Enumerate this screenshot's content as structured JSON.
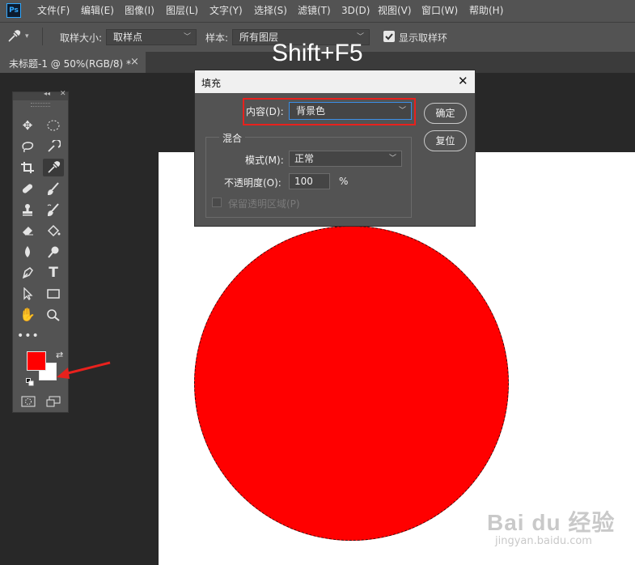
{
  "app": {
    "logo": "Ps"
  },
  "menu": [
    "文件(F)",
    "编辑(E)",
    "图像(I)",
    "图层(L)",
    "文字(Y)",
    "选择(S)",
    "滤镜(T)",
    "3D(D)",
    "视图(V)",
    "窗口(W)",
    "帮助(H)"
  ],
  "options": {
    "sample_size_label": "取样大小:",
    "sample_size_value": "取样点",
    "sample_label": "样本:",
    "sample_value": "所有图层",
    "show_ring_label": "显示取样环",
    "show_ring_checked": true
  },
  "tab": {
    "title": "未标题-1 @ 50%(RGB/8) *",
    "close": "×"
  },
  "annotation": {
    "shortcut": "Shift+F5"
  },
  "dialog": {
    "title": "填充",
    "close": "✕",
    "content_label": "内容(D):",
    "content_value": "背景色",
    "ok_label": "确定",
    "reset_label": "复位",
    "blend_group_label": "混合",
    "mode_label": "模式(M):",
    "mode_value": "正常",
    "opacity_label": "不透明度(O):",
    "opacity_value": "100",
    "opacity_unit": "%",
    "preserve_label": "保留透明区域(P)",
    "preserve_checked": false
  },
  "toolbox": {
    "foreground_color": "#ff0000",
    "background_color": "#ffffff",
    "tools": [
      "move-icon",
      "marquee-icon",
      "lasso-icon",
      "quick-select-icon",
      "crop-icon",
      "eyedropper-icon",
      "healing-icon",
      "brush-icon",
      "stamp-icon",
      "history-brush-icon",
      "eraser-icon",
      "paint-bucket-icon",
      "blur-icon",
      "dodge-icon",
      "pen-icon",
      "type-icon",
      "path-select-icon",
      "rectangle-icon",
      "hand-icon",
      "zoom-icon",
      "more-tools-icon"
    ]
  },
  "colors": {
    "highlight": "#e8211d",
    "arrow": "#e8211d",
    "fill": "#ff0000"
  },
  "watermark": {
    "text": "Bai du 经验",
    "url": "jingyan.baidu.com"
  }
}
